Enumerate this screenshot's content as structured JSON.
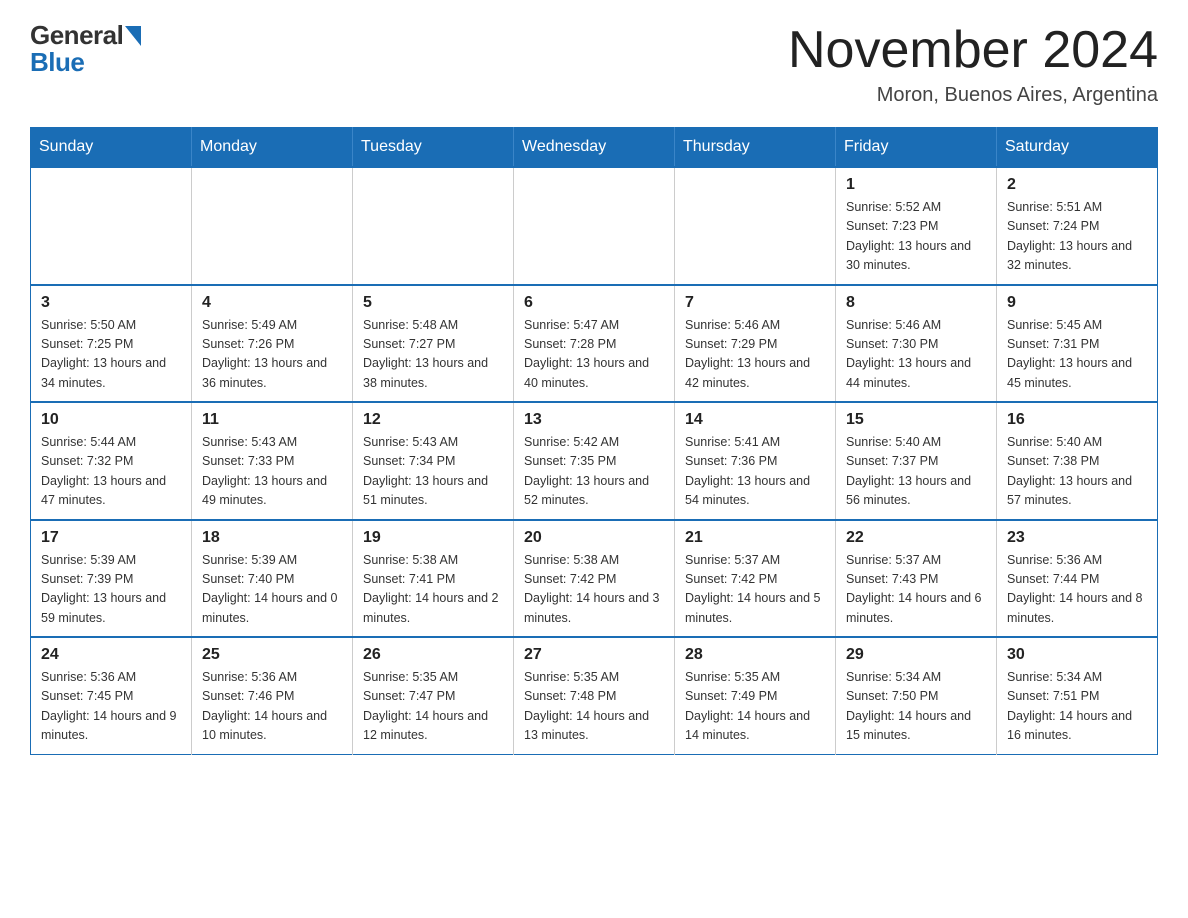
{
  "logo": {
    "general": "General",
    "triangle": "▶",
    "blue": "Blue"
  },
  "title": {
    "month": "November 2024",
    "location": "Moron, Buenos Aires, Argentina"
  },
  "weekdays": [
    "Sunday",
    "Monday",
    "Tuesday",
    "Wednesday",
    "Thursday",
    "Friday",
    "Saturday"
  ],
  "weeks": [
    [
      {
        "day": "",
        "info": ""
      },
      {
        "day": "",
        "info": ""
      },
      {
        "day": "",
        "info": ""
      },
      {
        "day": "",
        "info": ""
      },
      {
        "day": "",
        "info": ""
      },
      {
        "day": "1",
        "info": "Sunrise: 5:52 AM\nSunset: 7:23 PM\nDaylight: 13 hours and 30 minutes."
      },
      {
        "day": "2",
        "info": "Sunrise: 5:51 AM\nSunset: 7:24 PM\nDaylight: 13 hours and 32 minutes."
      }
    ],
    [
      {
        "day": "3",
        "info": "Sunrise: 5:50 AM\nSunset: 7:25 PM\nDaylight: 13 hours and 34 minutes."
      },
      {
        "day": "4",
        "info": "Sunrise: 5:49 AM\nSunset: 7:26 PM\nDaylight: 13 hours and 36 minutes."
      },
      {
        "day": "5",
        "info": "Sunrise: 5:48 AM\nSunset: 7:27 PM\nDaylight: 13 hours and 38 minutes."
      },
      {
        "day": "6",
        "info": "Sunrise: 5:47 AM\nSunset: 7:28 PM\nDaylight: 13 hours and 40 minutes."
      },
      {
        "day": "7",
        "info": "Sunrise: 5:46 AM\nSunset: 7:29 PM\nDaylight: 13 hours and 42 minutes."
      },
      {
        "day": "8",
        "info": "Sunrise: 5:46 AM\nSunset: 7:30 PM\nDaylight: 13 hours and 44 minutes."
      },
      {
        "day": "9",
        "info": "Sunrise: 5:45 AM\nSunset: 7:31 PM\nDaylight: 13 hours and 45 minutes."
      }
    ],
    [
      {
        "day": "10",
        "info": "Sunrise: 5:44 AM\nSunset: 7:32 PM\nDaylight: 13 hours and 47 minutes."
      },
      {
        "day": "11",
        "info": "Sunrise: 5:43 AM\nSunset: 7:33 PM\nDaylight: 13 hours and 49 minutes."
      },
      {
        "day": "12",
        "info": "Sunrise: 5:43 AM\nSunset: 7:34 PM\nDaylight: 13 hours and 51 minutes."
      },
      {
        "day": "13",
        "info": "Sunrise: 5:42 AM\nSunset: 7:35 PM\nDaylight: 13 hours and 52 minutes."
      },
      {
        "day": "14",
        "info": "Sunrise: 5:41 AM\nSunset: 7:36 PM\nDaylight: 13 hours and 54 minutes."
      },
      {
        "day": "15",
        "info": "Sunrise: 5:40 AM\nSunset: 7:37 PM\nDaylight: 13 hours and 56 minutes."
      },
      {
        "day": "16",
        "info": "Sunrise: 5:40 AM\nSunset: 7:38 PM\nDaylight: 13 hours and 57 minutes."
      }
    ],
    [
      {
        "day": "17",
        "info": "Sunrise: 5:39 AM\nSunset: 7:39 PM\nDaylight: 13 hours and 59 minutes."
      },
      {
        "day": "18",
        "info": "Sunrise: 5:39 AM\nSunset: 7:40 PM\nDaylight: 14 hours and 0 minutes."
      },
      {
        "day": "19",
        "info": "Sunrise: 5:38 AM\nSunset: 7:41 PM\nDaylight: 14 hours and 2 minutes."
      },
      {
        "day": "20",
        "info": "Sunrise: 5:38 AM\nSunset: 7:42 PM\nDaylight: 14 hours and 3 minutes."
      },
      {
        "day": "21",
        "info": "Sunrise: 5:37 AM\nSunset: 7:42 PM\nDaylight: 14 hours and 5 minutes."
      },
      {
        "day": "22",
        "info": "Sunrise: 5:37 AM\nSunset: 7:43 PM\nDaylight: 14 hours and 6 minutes."
      },
      {
        "day": "23",
        "info": "Sunrise: 5:36 AM\nSunset: 7:44 PM\nDaylight: 14 hours and 8 minutes."
      }
    ],
    [
      {
        "day": "24",
        "info": "Sunrise: 5:36 AM\nSunset: 7:45 PM\nDaylight: 14 hours and 9 minutes."
      },
      {
        "day": "25",
        "info": "Sunrise: 5:36 AM\nSunset: 7:46 PM\nDaylight: 14 hours and 10 minutes."
      },
      {
        "day": "26",
        "info": "Sunrise: 5:35 AM\nSunset: 7:47 PM\nDaylight: 14 hours and 12 minutes."
      },
      {
        "day": "27",
        "info": "Sunrise: 5:35 AM\nSunset: 7:48 PM\nDaylight: 14 hours and 13 minutes."
      },
      {
        "day": "28",
        "info": "Sunrise: 5:35 AM\nSunset: 7:49 PM\nDaylight: 14 hours and 14 minutes."
      },
      {
        "day": "29",
        "info": "Sunrise: 5:34 AM\nSunset: 7:50 PM\nDaylight: 14 hours and 15 minutes."
      },
      {
        "day": "30",
        "info": "Sunrise: 5:34 AM\nSunset: 7:51 PM\nDaylight: 14 hours and 16 minutes."
      }
    ]
  ]
}
